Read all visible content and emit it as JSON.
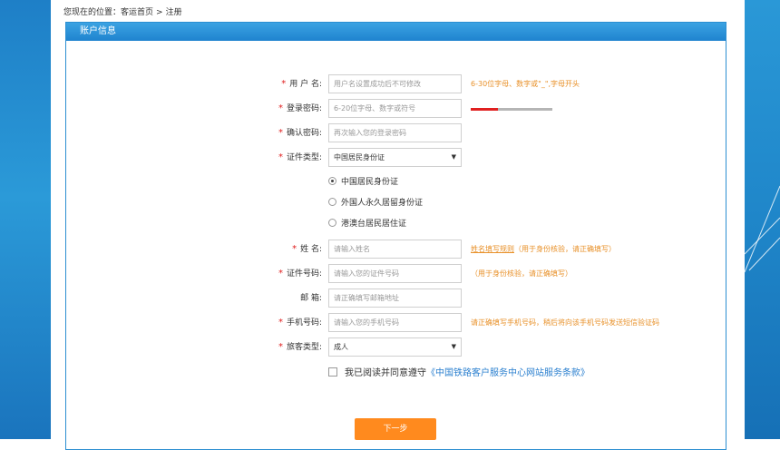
{
  "breadcrumb": {
    "prefix": "您现在的位置：",
    "home": "客运首页",
    "sep": ">",
    "current": "注册"
  },
  "panel": {
    "title": "账户信息"
  },
  "form": {
    "username": {
      "label": "用 户 名:",
      "placeholder": "用户名设置成功后不可修改",
      "hint": "6-30位字母、数字或\"_\",字母开头"
    },
    "password": {
      "label": "登录密码:",
      "placeholder": "6-20位字母、数字或符号",
      "strength_level": 1,
      "strength_max": 3
    },
    "confirm": {
      "label": "确认密码:",
      "placeholder": "再次输入您的登录密码"
    },
    "id_type": {
      "label": "证件类型:",
      "value": "中国居民身份证",
      "arrow": "▼",
      "options": [
        {
          "label": "中国居民身份证",
          "checked": true
        },
        {
          "label": "外国人永久居留身份证",
          "checked": false
        },
        {
          "label": "港澳台居民居住证",
          "checked": false
        }
      ]
    },
    "name": {
      "label": "姓 名:",
      "placeholder": "请输入姓名",
      "hint_link": "姓名填写规则",
      "hint": "（用于身份核验，请正确填写）"
    },
    "id_number": {
      "label": "证件号码:",
      "placeholder": "请输入您的证件号码",
      "hint": "（用于身份核验，请正确填写）"
    },
    "email": {
      "label": "邮 箱:",
      "placeholder": "请正确填写邮箱地址"
    },
    "phone": {
      "label": "手机号码:",
      "placeholder": "请输入您的手机号码",
      "hint": "请正确填写手机号码，稍后将向该手机号码发送短信验证码"
    },
    "passenger_type": {
      "label": "旅客类型:",
      "value": "成人",
      "arrow": "▼"
    },
    "agreement": {
      "text": "我已阅读并同意遵守",
      "link": "《中国铁路客户服务中心网站服务条款》"
    },
    "next_label": "下一步"
  },
  "required_mark": "*",
  "colors": {
    "accent": "#2b8ed1",
    "hint": "#e8912a",
    "button": "#ff8a1e",
    "required": "#e02020"
  }
}
